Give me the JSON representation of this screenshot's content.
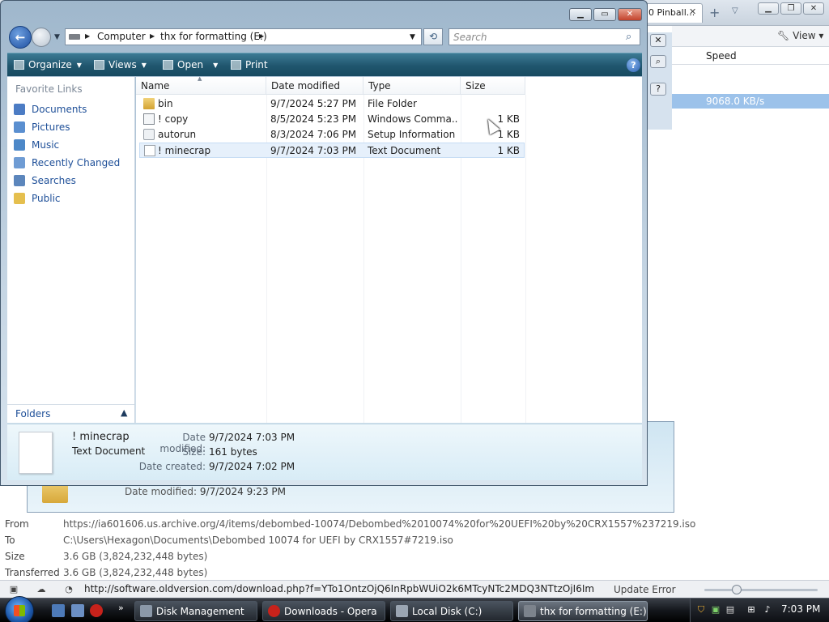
{
  "background_browser": {
    "tab_title": "0 Pinball...",
    "view_label": "View",
    "speed_header": "Speed",
    "speed_value": "9068.0 KB/s",
    "explorer_date_modified_label": "Date modified:",
    "explorer_date_modified_value": "9/7/2024 9:23 PM",
    "details": [
      {
        "label": "From",
        "value": "https://ia601606.us.archive.org/4/items/debombed-10074/Debombed%2010074%20for%20UEFI%20by%20CRX1557%237219.iso"
      },
      {
        "label": "To",
        "value": "C:\\Users\\Hexagon\\Documents\\Debombed 10074 for UEFI by CRX1557#7219.iso"
      },
      {
        "label": "Size",
        "value": "3.6 GB (3,824,232,448 bytes)"
      },
      {
        "label": "Transferred",
        "value": "3.6 GB (3,824,232,448 bytes)"
      }
    ],
    "status_url": "http://software.oldversion.com/download.php?f=YTo1OntzOjQ6InRpbWUiO2k6MTcyNTc2MDQ3NTtzOjI6ImlkIjtpOj...",
    "status_update": "Update Error"
  },
  "explorer": {
    "address": [
      "Computer",
      "thx for formatting (E:)"
    ],
    "search_placeholder": "Search",
    "commands": {
      "organize": "Organize",
      "views": "Views",
      "open": "Open",
      "print": "Print"
    },
    "nav": {
      "heading": "Favorite Links",
      "links": [
        "Documents",
        "Pictures",
        "Music",
        "Recently Changed",
        "Searches",
        "Public"
      ],
      "folders_label": "Folders"
    },
    "columns": [
      "Name",
      "Date modified",
      "Type",
      "Size"
    ],
    "files": [
      {
        "name": "bin",
        "date": "9/7/2024 5:27 PM",
        "type": "File Folder",
        "size": "",
        "icon": "folder-icon"
      },
      {
        "name": "! copy",
        "date": "8/5/2024 5:23 PM",
        "type": "Windows Comma...",
        "size": "1 KB",
        "icon": "batch-file-icon"
      },
      {
        "name": "autorun",
        "date": "8/3/2024 7:06 PM",
        "type": "Setup Information",
        "size": "1 KB",
        "icon": "setup-info-icon"
      },
      {
        "name": "! minecrap",
        "date": "9/7/2024 7:03 PM",
        "type": "Text Document",
        "size": "1 KB",
        "icon": "text-file-icon"
      }
    ],
    "details_pane": {
      "name": "! minecrap",
      "type": "Text Document",
      "date_modified_label": "Date modified:",
      "date_modified": "9/7/2024 7:03 PM",
      "size_label": "Size:",
      "size": "161 bytes",
      "date_created_label": "Date created:",
      "date_created": "9/7/2024 7:02 PM"
    }
  },
  "taskbar": {
    "buttons": [
      "Disk Management",
      "Downloads - Opera",
      "Local Disk (C:)",
      "thx for formatting (E:)"
    ],
    "clock": "7:03 PM"
  },
  "colors": {
    "accent": "#1e4f98",
    "command_bar": "#20566e",
    "selection": "#e6f0fb"
  }
}
